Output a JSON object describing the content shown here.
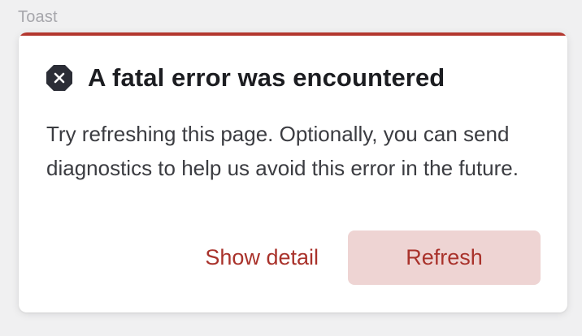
{
  "section_label": "Toast",
  "toast": {
    "accent_color": "#b3362e",
    "icon": "error-octagon-icon",
    "title": "A fatal error was encountered",
    "body": "Try refreshing this page. Optionally, you can send diagnostics to help us avoid this error in the future.",
    "actions": {
      "secondary_label": "Show detail",
      "primary_label": "Refresh"
    }
  }
}
